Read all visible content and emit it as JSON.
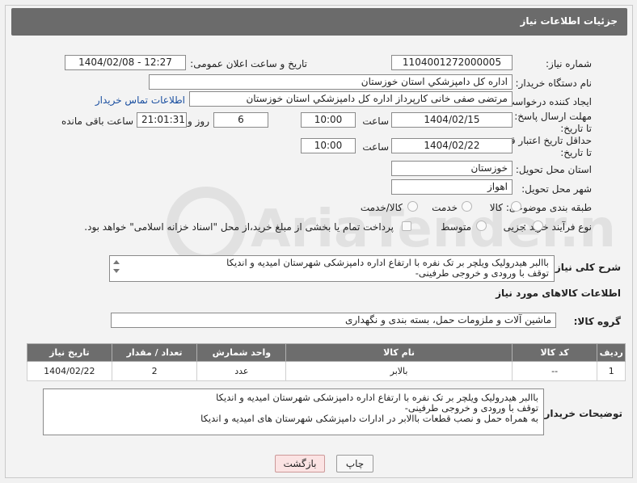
{
  "header": {
    "title": "جزئیات اطلاعات نیاز"
  },
  "labels": {
    "need_number": "شماره نیاز:",
    "announce_datetime": "تاریخ و ساعت اعلان عمومی:",
    "buyer_org": "نام دستگاه خریدار:",
    "requester": "ایجاد کننده درخواست:",
    "buyer_contact": "اطلاعات تماس خریدار",
    "reply_deadline": "مهلت ارسال پاسخ: تا تاریخ:",
    "time": "ساعت",
    "day_and": "روز و",
    "hours_remaining": "ساعت باقی مانده",
    "price_validity": "حداقل تاریخ اعتبار قیمت: تا تاریخ:",
    "time2": "ساعت",
    "delivery_province": "استان محل تحویل:",
    "delivery_city": "شهر محل تحویل:",
    "subject_category": "طبقه بندی موضوعی:",
    "purchase_process": "نوع فرآیند خرید :",
    "general_description": "شرح کلی نیاز:",
    "goods_info": "اطلاعات کالاهای مورد نیاز",
    "goods_group": "گروه کالا:",
    "buyer_notes": "توضیحات خریدار:"
  },
  "values": {
    "need_number": "1104001272000005",
    "announce_datetime": "1404/02/08 - 12:27",
    "buyer_org": "اداره کل دامپزشکي استان خوزستان",
    "requester": "مرتضی صفی خانی کارپرداز اداره کل دامپزشکي استان خوزستان",
    "reply_date": "1404/02/15",
    "reply_time": "10:00",
    "days": "6",
    "remaining": "21:01:31",
    "validity_date": "1404/02/22",
    "validity_time": "10:00",
    "province": "خوزستان",
    "city": "اهواز",
    "general_description": "باالبر هیدرولیک ویلچر بر تک نفره با ارتفاع  اداره دامپزشکی شهرستان امیدیه و اندیکا\nتوقف با ورودی و خروجی طرفینی-",
    "goods_group": "ماشین آلات و ملزومات حمل، بسته بندی و نگهداری",
    "buyer_notes": "باالبر هیدرولیک ویلچر بر تک نفره با ارتفاع  اداره دامپزشکی شهرستان امیدیه و اندیکا\nتوقف با ورودی و خروجی طرفینی-\nبه همراه حمل و نصب قطعات باالابر در ادارات دامپزشکی شهرستان های امیدیه و اندیکا"
  },
  "category_options": [
    "کالا",
    "خدمت",
    "کالا/خدمت"
  ],
  "process_options": [
    "جزیی",
    "متوسط"
  ],
  "treasury_note": "پرداخت تمام یا بخشی از مبلغ خرید،از محل \"اسناد خزانه اسلامی\" خواهد بود.",
  "table": {
    "headers": [
      "ردیف",
      "کد کالا",
      "نام کالا",
      "واحد شمارش",
      "تعداد / مقدار",
      "تاریخ نیاز"
    ],
    "rows": [
      [
        "1",
        "--",
        "بالابر",
        "عدد",
        "2",
        "1404/02/22"
      ]
    ]
  },
  "buttons": {
    "print": "چاپ",
    "back": "بازگشت"
  },
  "watermark": "AriaTender.neT"
}
